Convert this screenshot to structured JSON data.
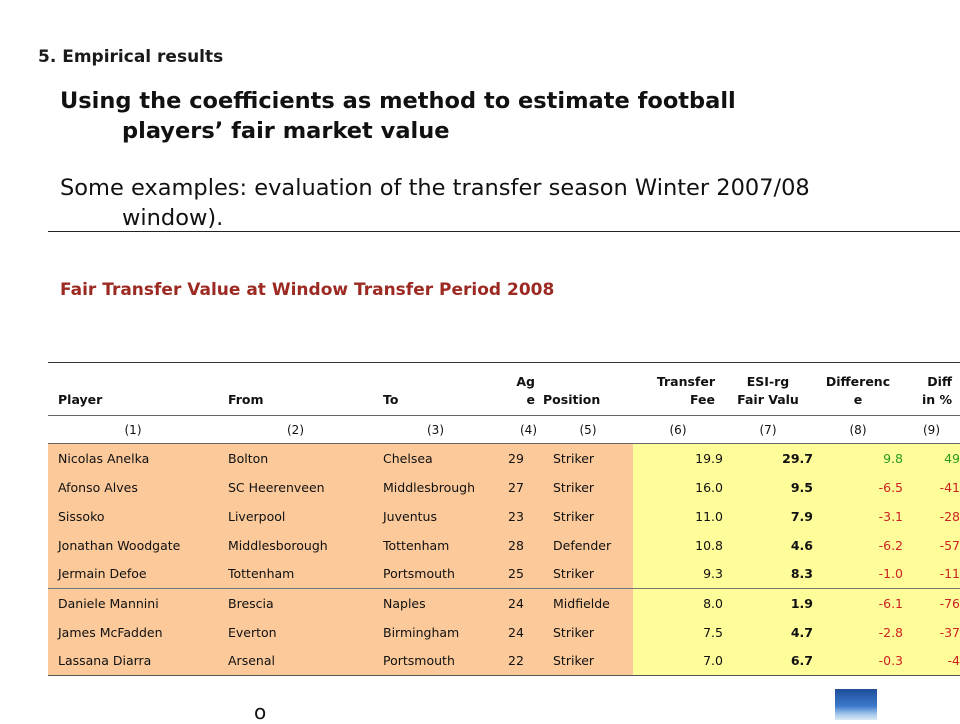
{
  "section_heading": "5. Empirical results",
  "bullet1": {
    "line1": "Using the coefficients as method to estimate football",
    "line2": "players’ fair market value"
  },
  "bullet2": {
    "line1": "Some examples: evaluation of the transfer season Winter 2007/08",
    "line2": "window)."
  },
  "table_title": "Fair Transfer Value at Window Transfer Period 2008",
  "columns": {
    "player": "Player",
    "from": "From",
    "to": "To",
    "age_line1": "Ag",
    "age_line2": "e",
    "position": "Position",
    "fee_line1": "Transfer",
    "fee_line2": "Fee",
    "fair_line1": "ESI-rg",
    "fair_line2": "Fair Valu",
    "diff_line1": "Differenc",
    "diff_line2": "e",
    "diffpct_line1": "Diff",
    "diffpct_line2": "in %"
  },
  "column_numbers": [
    "(1)",
    "(2)",
    "(3)",
    "(4)",
    "(5)",
    "(6)",
    "(7)",
    "(8)",
    "(9)"
  ],
  "rows": [
    {
      "player": "Nicolas Anelka",
      "from": "Bolton",
      "to": "Chelsea",
      "age": "29",
      "position": "Striker",
      "fee": "19.9",
      "fair": "29.7",
      "diff": "9.8",
      "diff_pct": "49"
    },
    {
      "player": "Afonso Alves",
      "from": "SC Heerenveen",
      "to": "Middlesbrough",
      "age": "27",
      "position": "Striker",
      "fee": "16.0",
      "fair": "9.5",
      "diff": "-6.5",
      "diff_pct": "-41"
    },
    {
      "player": "Sissoko",
      "from": "Liverpool",
      "to": "Juventus",
      "age": "23",
      "position": "Striker",
      "fee": "11.0",
      "fair": "7.9",
      "diff": "-3.1",
      "diff_pct": "-28"
    },
    {
      "player": "Jonathan Woodgate",
      "from": "Middlesborough",
      "to": "Tottenham",
      "age": "28",
      "position": "Defender",
      "fee": "10.8",
      "fair": "4.6",
      "diff": "-6.2",
      "diff_pct": "-57"
    },
    {
      "player": "Jermain Defoe",
      "from": "Tottenham",
      "to": "Portsmouth",
      "age": "25",
      "position": "Striker",
      "fee": "9.3",
      "fair": "8.3",
      "diff": "-1.0",
      "diff_pct": "-11"
    },
    {
      "player": "Daniele Mannini",
      "from": "Brescia",
      "to": "Naples",
      "age": "24",
      "position": "Midfielde",
      "fee": "8.0",
      "fair": "1.9",
      "diff": "-6.1",
      "diff_pct": "-76"
    },
    {
      "player": "James McFadden",
      "from": "Everton",
      "to": "Birmingham",
      "age": "24",
      "position": "Striker",
      "fee": "7.5",
      "fair": "4.7",
      "diff": "-2.8",
      "diff_pct": "-37"
    },
    {
      "player": "Lassana Diarra",
      "from": "Arsenal",
      "to": "Portsmouth",
      "age": "22",
      "position": "Striker",
      "fee": "7.0",
      "fair": "6.7",
      "diff": "-0.3",
      "diff_pct": "-4"
    }
  ],
  "colors": {
    "title_red": "#9c2a23",
    "orange_cell": "#fbc99a",
    "yellow_cell": "#fffd9a",
    "positive": "#2d9a22",
    "negative": "#cc2222"
  },
  "footnote": "o"
}
